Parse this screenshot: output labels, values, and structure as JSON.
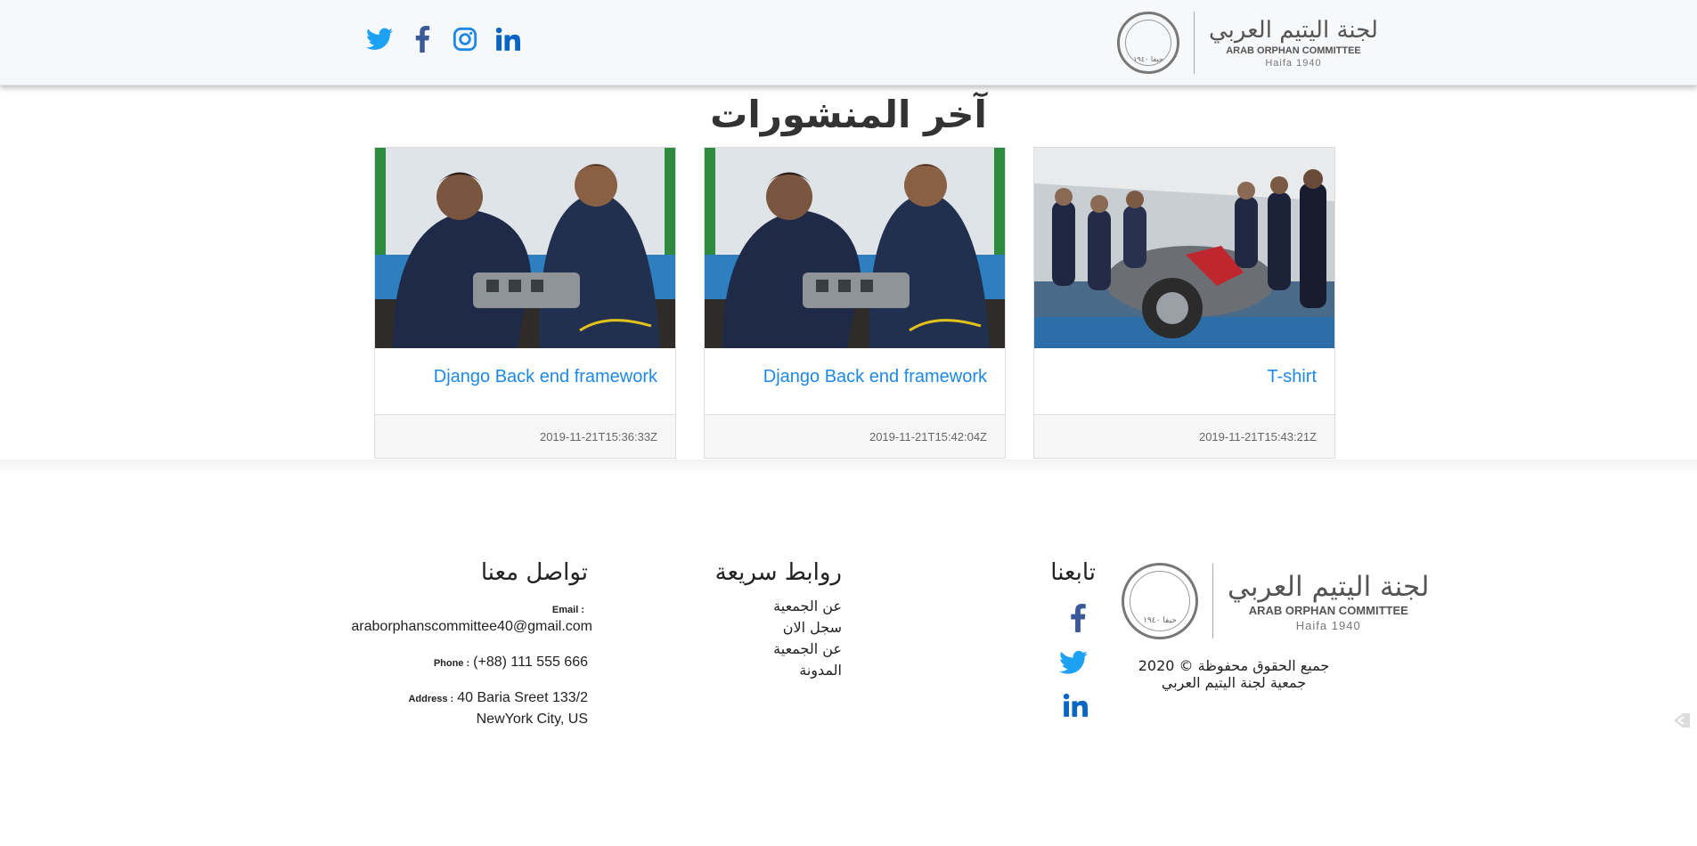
{
  "header": {
    "social_icons": [
      "twitter-icon",
      "facebook-icon",
      "instagram-icon",
      "linkedin-icon"
    ],
    "logo": {
      "arabic": "لجنة اليتيم العربي",
      "english": "ARAB ORPHAN COMMITTEE",
      "subtitle": "Haifa 1940",
      "seal_text": "حيفا ١٩٤٠"
    }
  },
  "posts": {
    "title": "آخر المنشورات",
    "cards": [
      {
        "title": "T-shirt",
        "date": "2019-11-21T15:43:21Z"
      },
      {
        "title": "Django Back end framework",
        "date": "2019-11-21T15:42:04Z"
      },
      {
        "title": "Django Back end framework",
        "date": "2019-11-21T15:36:33Z"
      }
    ]
  },
  "footer": {
    "contact": {
      "title": "تواصل معنا",
      "email_label": "Email :",
      "email": "araborphanscommittee40@gmail.com",
      "phone_label": "Phone :",
      "phone": "(+88) 111 555 666",
      "address_label": "Address :",
      "address_line1": "40 Baria Sreet 133/2",
      "address_line2": "NewYork City, US"
    },
    "quick_links": {
      "title": "روابط سريعة",
      "items": [
        "عن الجمعية",
        "سجل الان",
        "عن الجمعية",
        "المدونة"
      ]
    },
    "follow": {
      "title": "تابعنا",
      "icons": [
        "facebook-icon",
        "twitter-icon",
        "linkedin-icon"
      ]
    },
    "copyright_line1": "جميع الحقوق محفوظة © 2020",
    "copyright_line2": "جمعية لجنة اليتيم العربي"
  },
  "colors": {
    "twitter": "#1da1f2",
    "facebook": "#3b5998",
    "instagram": "#1e88e5",
    "linkedin": "#0a66c2",
    "link_blue": "#1e88e5"
  }
}
